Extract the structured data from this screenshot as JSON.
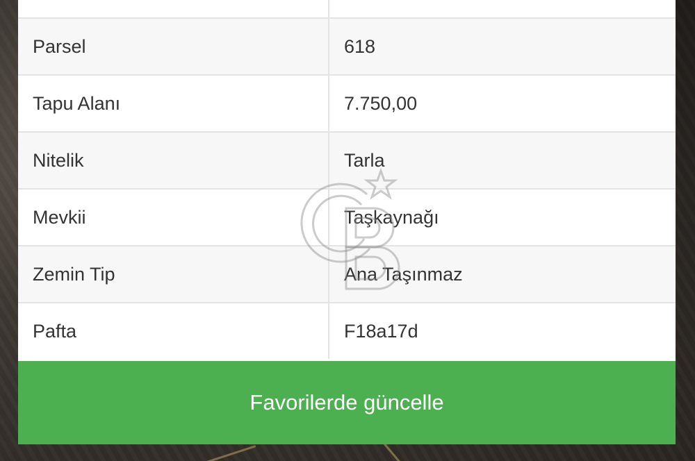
{
  "details": {
    "rows": [
      {
        "key": "",
        "value": ""
      },
      {
        "key": "Parsel",
        "value": "618"
      },
      {
        "key": "Tapu Alanı",
        "value": "7.750,00"
      },
      {
        "key": "Nitelik",
        "value": "Tarla"
      },
      {
        "key": "Mevkii",
        "value": "Taşkaynağı"
      },
      {
        "key": "Zemin Tip",
        "value": "Ana Taşınmaz"
      },
      {
        "key": "Pafta",
        "value": "F18a17d"
      }
    ]
  },
  "action": {
    "label": "Favorilerde güncelle",
    "color": "#4caf50"
  },
  "watermark": {
    "icon": "brand-logo-watermark"
  }
}
